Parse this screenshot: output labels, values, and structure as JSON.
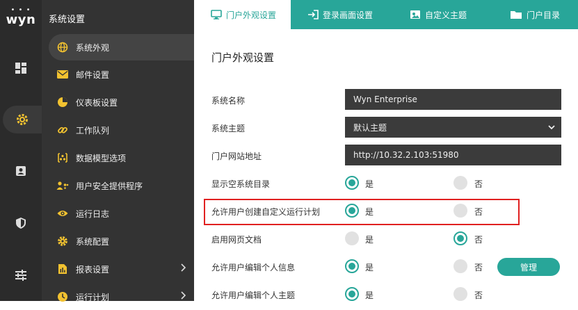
{
  "brand": {
    "logo_text": "wyn"
  },
  "rail": [
    {
      "icon": "dashboard-icon"
    },
    {
      "icon": "gear-icon"
    },
    {
      "icon": "user-card-icon"
    },
    {
      "icon": "shield-icon"
    },
    {
      "icon": "sliders-icon"
    }
  ],
  "menu": {
    "title": "系统设置",
    "items": [
      {
        "label": "系统外观",
        "icon": "globe-icon"
      },
      {
        "label": "邮件设置",
        "icon": "mail-icon"
      },
      {
        "label": "仪表板设置",
        "icon": "pie-chart-icon"
      },
      {
        "label": "工作队列",
        "icon": "link-icon"
      },
      {
        "label": "数据模型选项",
        "icon": "model-icon"
      },
      {
        "label": "用户安全提供程序",
        "icon": "users-icon"
      },
      {
        "label": "运行日志",
        "icon": "eye-icon"
      },
      {
        "label": "系统配置",
        "icon": "cog-icon"
      },
      {
        "label": "报表设置",
        "icon": "report-icon"
      },
      {
        "label": "运行计划",
        "icon": "clock-icon"
      }
    ]
  },
  "tabs": [
    {
      "label": "门户外观设置",
      "icon": "monitor-icon"
    },
    {
      "label": "登录画面设置",
      "icon": "login-icon"
    },
    {
      "label": "自定义主题",
      "icon": "theme-icon"
    },
    {
      "label": "门户目录",
      "icon": "folder-icon"
    }
  ],
  "content": {
    "title": "门户外观设置",
    "system_name_label": "系统名称",
    "system_name_value": "Wyn Enterprise",
    "system_theme_label": "系统主题",
    "system_theme_value": "默认主题",
    "portal_url_label": "门户网站地址",
    "portal_url_value": "http://10.32.2.103:51980",
    "yes": "是",
    "no": "否",
    "options": [
      {
        "label": "显示空系统目录",
        "value": "是"
      },
      {
        "label": "允许用户创建自定义运行计划",
        "value": "是"
      },
      {
        "label": "启用网页文档",
        "value": "否"
      },
      {
        "label": "允许用户编辑个人信息",
        "value": "是"
      },
      {
        "label": "允许用户编辑个人主题",
        "value": "是"
      }
    ],
    "manage_button": "管理"
  },
  "colors": {
    "accent": "#28a699",
    "highlight": "#e02020",
    "sidebar": "#333333",
    "rail": "#2b2b2b"
  }
}
